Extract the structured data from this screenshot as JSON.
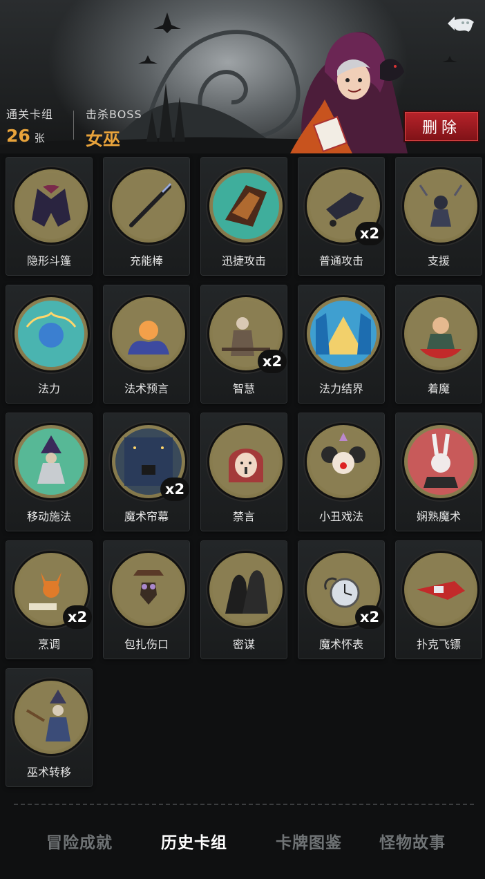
{
  "header": {
    "stats": {
      "cleared_deck_label": "通关卡组",
      "cleared_deck_value": "26",
      "cleared_deck_unit": "张",
      "boss_label": "击杀BOSS",
      "boss_value": "女巫"
    },
    "delete_label": "删除"
  },
  "cards": [
    {
      "name": "隐形斗篷",
      "count": "",
      "icon": "cloak-icon",
      "bg": "#8a7e52"
    },
    {
      "name": "充能棒",
      "count": "",
      "icon": "wand-icon",
      "bg": "#8a7e52"
    },
    {
      "name": "迅捷攻击",
      "count": "",
      "icon": "gauntlet-icon",
      "bg": "#3fae9c"
    },
    {
      "name": "普通攻击",
      "count": "x2",
      "icon": "crow-attack-icon",
      "bg": "#8a7e52"
    },
    {
      "name": "支援",
      "count": "",
      "icon": "support-icon",
      "bg": "#8a7e52"
    },
    {
      "name": "法力",
      "count": "",
      "icon": "mana-orb-icon",
      "bg": "#4ab4b0"
    },
    {
      "name": "法术预言",
      "count": "",
      "icon": "crystal-ball-icon",
      "bg": "#8a7e52"
    },
    {
      "name": "智慧",
      "count": "x2",
      "icon": "sage-icon",
      "bg": "#8a7e52"
    },
    {
      "name": "法力结界",
      "count": "",
      "icon": "barrier-icon",
      "bg": "#3f9fd0"
    },
    {
      "name": "着魔",
      "count": "",
      "icon": "possessed-icon",
      "bg": "#8a7e52"
    },
    {
      "name": "移动施法",
      "count": "",
      "icon": "wizard-icon",
      "bg": "#57b896"
    },
    {
      "name": "魔术帘幕",
      "count": "x2",
      "icon": "magic-curtain-icon",
      "bg": "#3a4a5a"
    },
    {
      "name": "禁言",
      "count": "",
      "icon": "silence-icon",
      "bg": "#8a7e52"
    },
    {
      "name": "小丑戏法",
      "count": "",
      "icon": "clown-icon",
      "bg": "#8a7e52"
    },
    {
      "name": "娴熟魔术",
      "count": "",
      "icon": "rabbit-magician-icon",
      "bg": "#c85a5a"
    },
    {
      "name": "烹调",
      "count": "x2",
      "icon": "cooking-fox-icon",
      "bg": "#8a7e52"
    },
    {
      "name": "包扎伤口",
      "count": "",
      "icon": "plague-doctor-icon",
      "bg": "#8a7e52"
    },
    {
      "name": "密谋",
      "count": "",
      "icon": "hooded-figures-icon",
      "bg": "#8a7e52"
    },
    {
      "name": "魔术怀表",
      "count": "x2",
      "icon": "pocket-watch-icon",
      "bg": "#8a7e52"
    },
    {
      "name": "扑克飞镖",
      "count": "",
      "icon": "poker-dart-icon",
      "bg": "#8a7e52"
    },
    {
      "name": "巫术转移",
      "count": "",
      "icon": "sorcery-transfer-icon",
      "bg": "#8a7e52"
    }
  ],
  "nav": {
    "tabs": [
      {
        "label": "冒险成就",
        "active": false
      },
      {
        "label": "历史卡组",
        "active": true
      },
      {
        "label": "卡牌图鉴",
        "active": false
      },
      {
        "label": "怪物故事",
        "active": false
      }
    ]
  },
  "colors": {
    "accent_orange": "#e8a33b",
    "delete_red": "#b8232a",
    "medal_gold": "#85794c"
  }
}
